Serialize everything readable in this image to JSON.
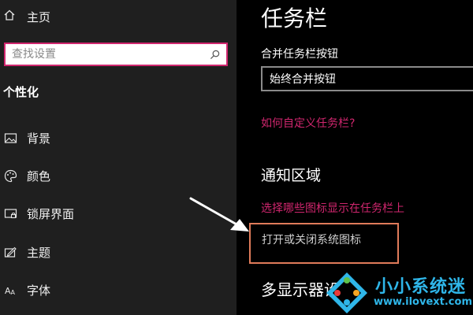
{
  "sidebar": {
    "home_label": "主页",
    "search_placeholder": "查找设置",
    "section_title": "个性化",
    "items": [
      {
        "label": "背景",
        "icon": "image-icon"
      },
      {
        "label": "颜色",
        "icon": "palette-icon"
      },
      {
        "label": "锁屏界面",
        "icon": "lock-screen-icon"
      },
      {
        "label": "主题",
        "icon": "theme-icon"
      },
      {
        "label": "字体",
        "icon": "font-icon"
      }
    ]
  },
  "main": {
    "title": "任务栏",
    "combine_label": "合并任务栏按钮",
    "combine_value": "始终合并按钮",
    "customize_link": "如何自定义任务栏?",
    "notify_heading": "通知区域",
    "choose_icons_link": "选择哪些图标显示在任务栏上",
    "toggle_system_icons_link": "打开或关闭系统图标",
    "multi_display_heading": "多显示器设置"
  },
  "watermark": {
    "title": "小小系统迷",
    "url": "www.ilovext.com"
  },
  "colors": {
    "accent": "#d0266e",
    "highlight_box": "#e07b5a",
    "watermark": "#2fb6e9",
    "sidebar_bg": "#1f1f1f",
    "main_bg": "#000000"
  }
}
